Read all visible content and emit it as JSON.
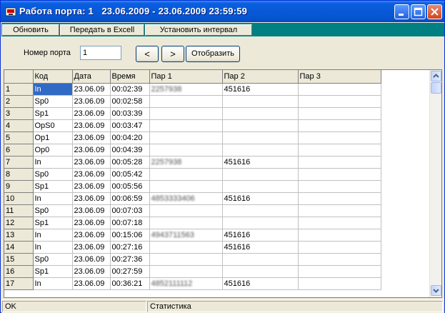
{
  "window": {
    "title": "Работа порта: 1   23.06.2009 - 23.06.2009 23:59:59"
  },
  "menu": {
    "refresh_label": "Обновить",
    "export_label": "Передать в Excell",
    "interval_label": "Установить интервал"
  },
  "toolbar": {
    "port_label": "Номер порта",
    "port_value": "1",
    "prev_label": "<",
    "next_label": ">",
    "show_label": "Отобразить"
  },
  "table": {
    "columns": [
      "Код",
      "Дата",
      "Время",
      "Пар 1",
      "Пар 2",
      "Пар 3"
    ],
    "rows": [
      {
        "n": "1",
        "code": "In",
        "date": "23.06.09",
        "time": "00:02:39",
        "p1": "2257938",
        "p2": "451616",
        "p3": ""
      },
      {
        "n": "2",
        "code": "Sp0",
        "date": "23.06.09",
        "time": "00:02:58",
        "p1": "",
        "p2": "",
        "p3": ""
      },
      {
        "n": "3",
        "code": "Sp1",
        "date": "23.06.09",
        "time": "00:03:39",
        "p1": "",
        "p2": "",
        "p3": ""
      },
      {
        "n": "4",
        "code": "OpS0",
        "date": "23.06.09",
        "time": "00:03:47",
        "p1": "",
        "p2": "",
        "p3": ""
      },
      {
        "n": "5",
        "code": "Op1",
        "date": "23.06.09",
        "time": "00:04:20",
        "p1": "",
        "p2": "",
        "p3": ""
      },
      {
        "n": "6",
        "code": "Op0",
        "date": "23.06.09",
        "time": "00:04:39",
        "p1": "",
        "p2": "",
        "p3": ""
      },
      {
        "n": "7",
        "code": "In",
        "date": "23.06.09",
        "time": "00:05:28",
        "p1": "2257938",
        "p2": "451616",
        "p3": ""
      },
      {
        "n": "8",
        "code": "Sp0",
        "date": "23.06.09",
        "time": "00:05:42",
        "p1": "",
        "p2": "",
        "p3": ""
      },
      {
        "n": "9",
        "code": "Sp1",
        "date": "23.06.09",
        "time": "00:05:56",
        "p1": "",
        "p2": "",
        "p3": ""
      },
      {
        "n": "10",
        "code": "In",
        "date": "23.06.09",
        "time": "00:06:59",
        "p1": "4853333406",
        "p2": "451616",
        "p3": ""
      },
      {
        "n": "11",
        "code": "Sp0",
        "date": "23.06.09",
        "time": "00:07:03",
        "p1": "",
        "p2": "",
        "p3": ""
      },
      {
        "n": "12",
        "code": "Sp1",
        "date": "23.06.09",
        "time": "00:07:18",
        "p1": "",
        "p2": "",
        "p3": ""
      },
      {
        "n": "13",
        "code": "In",
        "date": "23.06.09",
        "time": "00:15:06",
        "p1": "4943711563",
        "p2": "451616",
        "p3": ""
      },
      {
        "n": "14",
        "code": "In",
        "date": "23.06.09",
        "time": "00:27:16",
        "p1": "",
        "p2": "451616",
        "p3": ""
      },
      {
        "n": "15",
        "code": "Sp0",
        "date": "23.06.09",
        "time": "00:27:36",
        "p1": "",
        "p2": "",
        "p3": ""
      },
      {
        "n": "16",
        "code": "Sp1",
        "date": "23.06.09",
        "time": "00:27:59",
        "p1": "",
        "p2": "",
        "p3": ""
      },
      {
        "n": "17",
        "code": "In",
        "date": "23.06.09",
        "time": "00:36:21",
        "p1": "4852111112",
        "p2": "451616",
        "p3": ""
      }
    ]
  },
  "status": {
    "left": "OK",
    "right": "Статистика"
  }
}
